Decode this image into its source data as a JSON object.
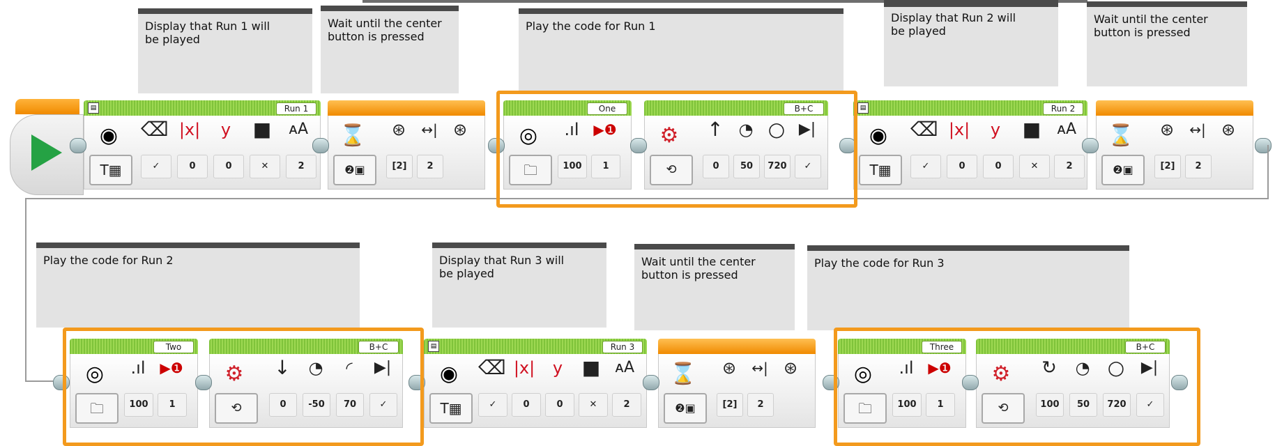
{
  "comments": [
    {
      "text": "Display that Run 1 will\nbe played"
    },
    {
      "text": "Wait until the center\nbutton is pressed"
    },
    {
      "text": "Play the code for Run 1"
    },
    {
      "text": "Display that Run 2 will\nbe played"
    },
    {
      "text": "Wait until the center\nbutton is pressed"
    },
    {
      "text": "Play the code for Run 2"
    },
    {
      "text": "Display that Run 3 will\nbe played"
    },
    {
      "text": "Wait until the center\nbutton is pressed"
    },
    {
      "text": "Play the code for Run 3"
    }
  ],
  "row1": {
    "display1": {
      "label": "Run 1",
      "values": [
        "✓",
        "0",
        "0",
        "✕",
        "2"
      ]
    },
    "wait1": {
      "values": [
        "[2]",
        "2"
      ]
    },
    "sound1": {
      "label": "One",
      "values": [
        "100",
        "1"
      ]
    },
    "move1": {
      "label": "B+C",
      "values": [
        "0",
        "50",
        "720",
        "✓"
      ]
    },
    "display2": {
      "label": "Run 2",
      "values": [
        "✓",
        "0",
        "0",
        "✕",
        "2"
      ]
    },
    "wait2": {
      "values": [
        "[2]",
        "2"
      ]
    }
  },
  "row2": {
    "sound2": {
      "label": "Two",
      "values": [
        "100",
        "1"
      ]
    },
    "move2": {
      "label": "B+C",
      "values": [
        "0",
        "-50",
        "70",
        "✓"
      ]
    },
    "display3": {
      "label": "Run 3",
      "values": [
        "✓",
        "0",
        "0",
        "✕",
        "2"
      ]
    },
    "wait3": {
      "values": [
        "[2]",
        "2"
      ]
    },
    "sound3": {
      "label": "Three",
      "values": [
        "100",
        "1"
      ]
    },
    "move3": {
      "label": "B+C",
      "values": [
        "100",
        "50",
        "720",
        "✓"
      ]
    }
  },
  "icons": {
    "start": "play-triangle",
    "display": [
      "eraser-icon",
      "x-coordinate-icon",
      "y-coordinate-icon",
      "color-icon",
      "font-size-icon"
    ],
    "wait": [
      "hourglass-icon",
      "brick-button-icon"
    ],
    "sound": [
      "speaker-icon",
      "volume-icon",
      "play-type-icon"
    ],
    "move": [
      "steering-icon",
      "power-icon",
      "degrees-icon",
      "brake-icon"
    ]
  },
  "colors": {
    "highlight": "#f39a1d",
    "start_play": "#25a244",
    "green_header": "#7fc33a",
    "orange_header": "#f08a00"
  }
}
